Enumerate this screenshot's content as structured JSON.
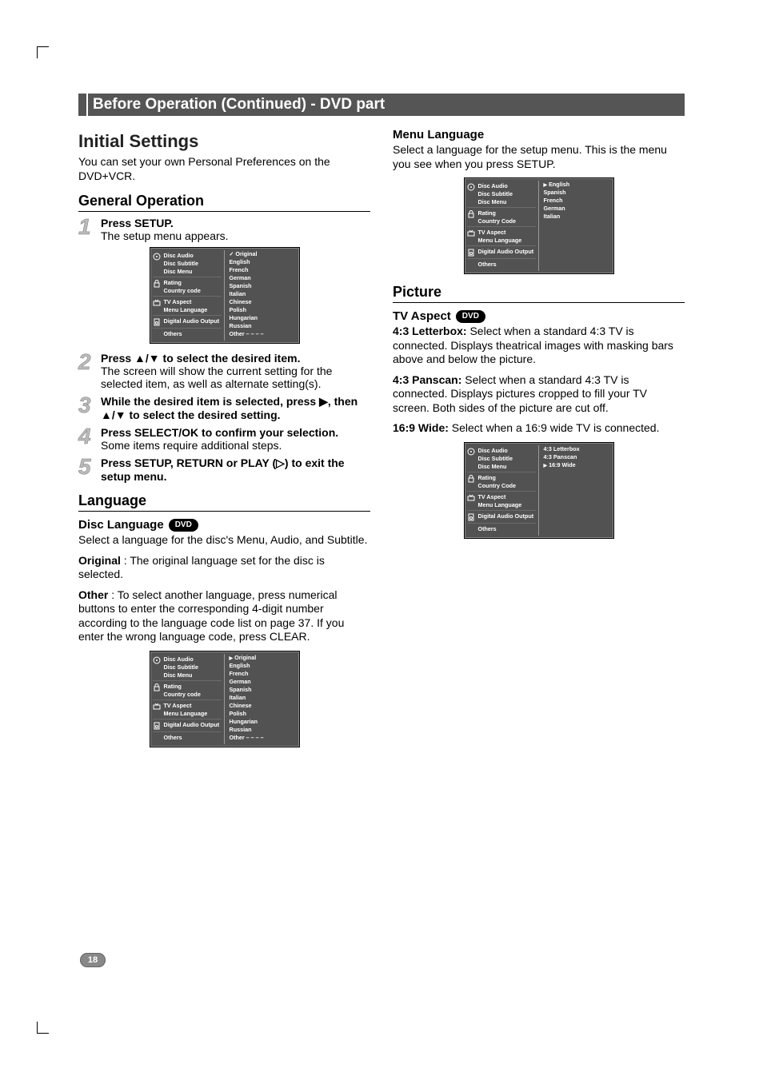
{
  "page_number": "18",
  "title_bar": "Before Operation (Continued) - DVD part",
  "left": {
    "h1": "Initial Settings",
    "intro": "You can set your own Personal Preferences on the DVD+VCR.",
    "h2_general": "General Operation",
    "steps": {
      "s1_lead": "Press SETUP.",
      "s1_body": "The setup menu appears.",
      "s2_lead": "Press ▲/▼ to select the desired item.",
      "s2_body": "The screen will show the current setting for the selected item, as well as alternate setting(s).",
      "s3_lead": "While the desired item is selected, press ▶, then ▲/▼ to select the desired setting.",
      "s4_lead": "Press SELECT/OK to confirm your selection.",
      "s4_body": "Some items require additional steps.",
      "s5_lead": "Press SETUP, RETURN or PLAY (▷) to exit the setup menu."
    },
    "h2_language": "Language",
    "h3_disc_language": "Disc Language",
    "disc_language_p1": "Select a language for the disc's Menu, Audio, and Subtitle.",
    "disc_language_original_label": "Original",
    "disc_language_original_text": " : The original language set for the disc is selected.",
    "disc_language_other_label": "Other",
    "disc_language_other_text": " : To select another language, press numerical buttons to enter the corresponding 4-digit number according to the language code list on page 37. If you enter the wrong language code, press CLEAR."
  },
  "right": {
    "h3_menu_language": "Menu Language",
    "menu_language_p": "Select a language for the setup menu. This is the menu you see when you press SETUP.",
    "h2_picture": "Picture",
    "h3_tv_aspect": "TV Aspect",
    "tv_43lb_label": "4:3 Letterbox:",
    "tv_43lb_text": " Select when a standard 4:3 TV is connected. Displays theatrical images with masking bars above and below the picture.",
    "tv_43ps_label": "4:3 Panscan:",
    "tv_43ps_text": " Select when a standard 4:3 TV is connected. Displays pictures cropped to fill your TV screen. Both sides of the picture are cut off.",
    "tv_169_label": "16:9 Wide:",
    "tv_169_text": " Select when a 16:9 wide TV is connected."
  },
  "dvd_badge": "DVD",
  "osd": {
    "menu_items": {
      "grp1": [
        "Disc Audio",
        "Disc Subtitle",
        "Disc Menu"
      ],
      "grp2_a": [
        "Rating",
        "Country code"
      ],
      "grp2_b": [
        "Rating",
        "Country Code"
      ],
      "grp3": [
        "TV Aspect",
        "Menu Language"
      ],
      "grp4": [
        "Digital Audio Output"
      ],
      "grp5": [
        "Others"
      ]
    },
    "right_lang_full": [
      "Original",
      "English",
      "French",
      "German",
      "Spanish",
      "Italian",
      "Chinese",
      "Polish",
      "Hungarian",
      "Russian",
      "Other  – – – –"
    ],
    "right_menu_lang": [
      "English",
      "Spanish",
      "French",
      "German",
      "Italian"
    ],
    "right_aspect": [
      "4:3 Letterbox",
      "4:3 Panscan",
      "16:9 Wide"
    ]
  }
}
